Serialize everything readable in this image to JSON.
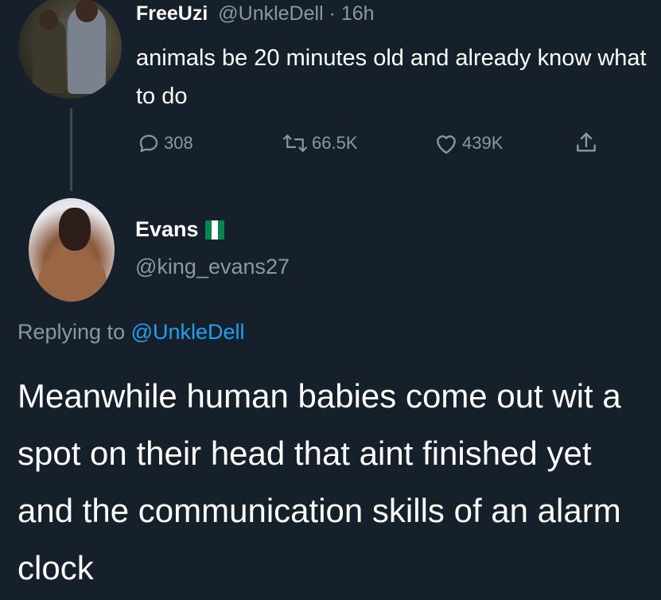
{
  "tweet1": {
    "display_name": "FreeUzi",
    "handle": "@UnkleDell",
    "separator": " · ",
    "time": "16h",
    "text": "animals be 20 minutes old and already know what to do",
    "actions": {
      "reply_icon": "comment-icon",
      "reply_count": "308",
      "retweet_icon": "retweet-icon",
      "retweet_count": "66.5K",
      "like_icon": "heart-icon",
      "like_count": "439K",
      "share_icon": "share-icon"
    }
  },
  "tweet2": {
    "display_name": "Evans",
    "flag": "nigeria-flag",
    "handle": "@king_evans27",
    "replying_prefix": "Replying to ",
    "replying_handle": "@UnkleDell",
    "text": "Meanwhile human babies come out wit a spot on their head that aint finished yet and the communication skills of an alarm clock"
  },
  "colors": {
    "background": "#15202b",
    "muted": "#8899a6",
    "link": "#1da1f2",
    "text": "#ffffff",
    "flag_green": "#008751",
    "flag_white": "#ffffff"
  }
}
